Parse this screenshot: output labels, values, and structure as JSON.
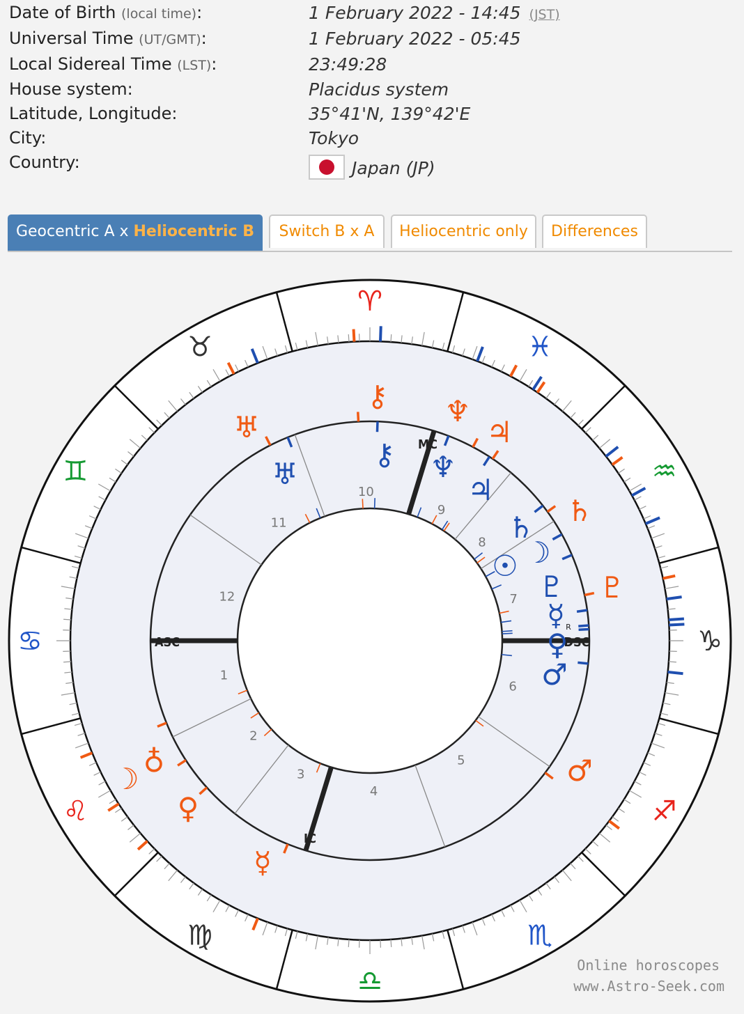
{
  "info": {
    "dob_label": "Date of Birth",
    "dob_note": "(local time)",
    "dob_value": "1 February 2022 - 14:45",
    "dob_tz": "(JST)",
    "ut_label": "Universal Time",
    "ut_note": "(UT/GMT)",
    "ut_value": "1 February 2022 - 05:45",
    "lst_label": "Local Sidereal Time",
    "lst_note": "(LST)",
    "lst_value": "23:49:28",
    "house_label": "House system:",
    "house_value": "Placidus system",
    "latlon_label": "Latitude, Longitude:",
    "latlon_value": "35°41'N, 139°42'E",
    "city_label": "City:",
    "city_value": "Tokyo",
    "country_label": "Country:",
    "country_value": "Japan (JP)"
  },
  "tabs": {
    "geo_a": "Geocentric A x ",
    "helio_b": "Heliocentric B",
    "switch": "Switch B x A",
    "helio_only": "Heliocentric only",
    "differences": "Differences"
  },
  "colors": {
    "geocentric": "#1f4fb0",
    "heliocentric": "#f05a14",
    "tab_active": "#4a7fb5",
    "tab_text": "#f08a00"
  },
  "chart": {
    "signs": [
      {
        "glyph": "♈",
        "color": "#e8241c"
      },
      {
        "glyph": "♓",
        "color": "#2156c8"
      },
      {
        "glyph": "♒",
        "color": "#159a32"
      },
      {
        "glyph": "♑",
        "color": "#333333"
      },
      {
        "glyph": "♐",
        "color": "#e8241c"
      },
      {
        "glyph": "♏",
        "color": "#2156c8"
      },
      {
        "glyph": "♎",
        "color": "#159a32"
      },
      {
        "glyph": "♍",
        "color": "#333333"
      },
      {
        "glyph": "♌",
        "color": "#e8241c"
      },
      {
        "glyph": "♋",
        "color": "#2156c8"
      },
      {
        "glyph": "♊",
        "color": "#159a32"
      },
      {
        "glyph": "♉",
        "color": "#333333"
      }
    ],
    "houses": [
      "1",
      "2",
      "3",
      "4",
      "5",
      "6",
      "7",
      "8",
      "9",
      "10",
      "11",
      "12"
    ],
    "angles": {
      "asc": "ASC",
      "mc": "MC",
      "ic": "IC",
      "dsc": "DSC"
    },
    "retrograde": "R",
    "helio_planets": [
      {
        "name": "chiron",
        "glyph": "⚷"
      },
      {
        "name": "neptune",
        "glyph": "♆"
      },
      {
        "name": "jupiter",
        "glyph": "♃"
      },
      {
        "name": "uranus",
        "glyph": "♅"
      },
      {
        "name": "saturn",
        "glyph": "♄"
      },
      {
        "name": "pluto",
        "glyph": "♇"
      },
      {
        "name": "mars",
        "glyph": "♂"
      },
      {
        "name": "earth",
        "glyph": "♁"
      },
      {
        "name": "moon",
        "glyph": "☽"
      },
      {
        "name": "venus",
        "glyph": "♀"
      },
      {
        "name": "mercury",
        "glyph": "☿"
      }
    ],
    "geo_planets": [
      {
        "name": "chiron",
        "glyph": "⚷"
      },
      {
        "name": "neptune",
        "glyph": "♆"
      },
      {
        "name": "uranus",
        "glyph": "♅"
      },
      {
        "name": "jupiter",
        "glyph": "♃"
      },
      {
        "name": "saturn",
        "glyph": "♄"
      },
      {
        "name": "moon",
        "glyph": "☽"
      },
      {
        "name": "sun",
        "glyph": "☉"
      },
      {
        "name": "pluto",
        "glyph": "♇"
      },
      {
        "name": "mercury",
        "glyph": "☿"
      },
      {
        "name": "venus",
        "glyph": "♀"
      },
      {
        "name": "mars",
        "glyph": "♂"
      }
    ]
  },
  "watermark": {
    "line1": "Online horoscopes",
    "line2": "www.Astro-Seek.com"
  }
}
